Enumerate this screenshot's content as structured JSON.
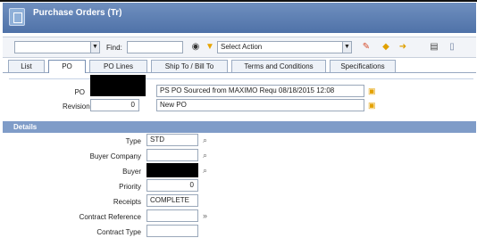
{
  "app": {
    "title": "Purchase Orders (Tr)"
  },
  "toolbar": {
    "find_label": "Find:",
    "select_action": "Select Action"
  },
  "tabs": [
    {
      "label": "List"
    },
    {
      "label": "PO"
    },
    {
      "label": "PO Lines"
    },
    {
      "label": "Ship To / Bill To"
    },
    {
      "label": "Terms and Conditions"
    },
    {
      "label": "Specifications"
    }
  ],
  "header": {
    "po_label": "PO",
    "po_description": "PS PO Sourced from MAXIMO Requ 08/18/2015 12:08",
    "revision_label": "Revision",
    "revision_value": "0",
    "revision_description": "New PO"
  },
  "details": {
    "section_label": "Details",
    "type_label": "Type",
    "type_value": "STD",
    "buyer_company_label": "Buyer Company",
    "buyer_label": "Buyer",
    "priority_label": "Priority",
    "priority_value": "0",
    "receipts_label": "Receipts",
    "receipts_value": "COMPLETE",
    "contract_reference_label": "Contract Reference",
    "contract_type_label": "Contract Type"
  }
}
